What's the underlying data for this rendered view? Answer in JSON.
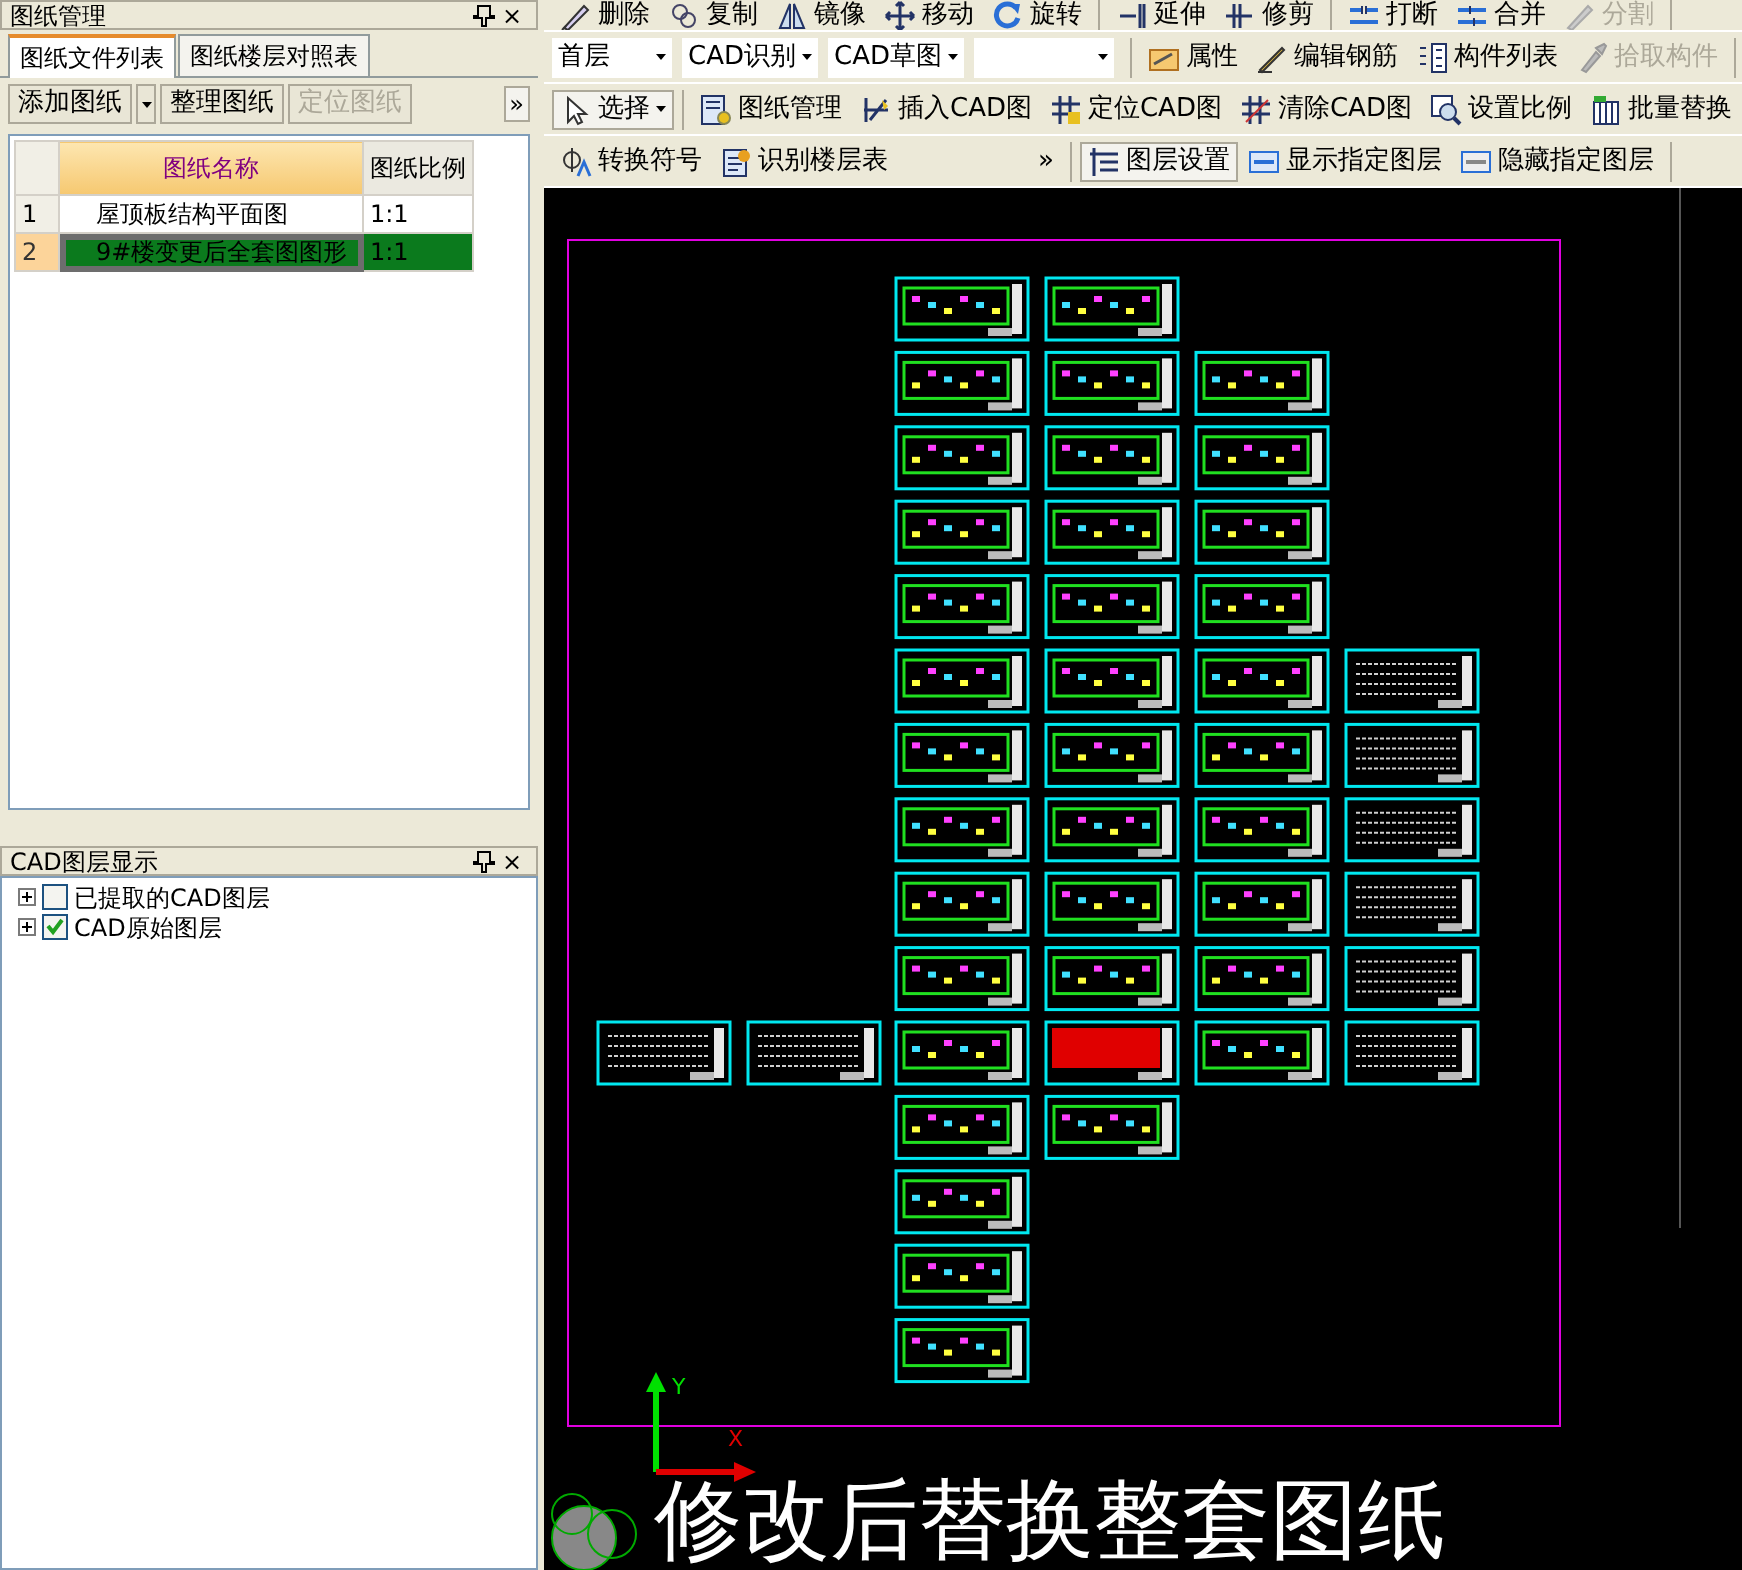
{
  "left_panel": {
    "title": "图纸管理",
    "close": "×",
    "tabs": [
      {
        "label": "图纸文件列表",
        "selected": true
      },
      {
        "label": "图纸楼层对照表",
        "selected": false
      }
    ],
    "toolbar": [
      {
        "label": "添加图纸",
        "kind": "split",
        "disabled": false
      },
      {
        "label": "整理图纸",
        "kind": "button",
        "disabled": false
      },
      {
        "label": "定位图纸",
        "kind": "button",
        "disabled": true
      }
    ],
    "overflow": "»",
    "table": {
      "columns": [
        "图纸名称",
        "图纸比例"
      ],
      "rows": [
        {
          "index": "1",
          "name": "屋顶板结构平面图",
          "scale": "1:1",
          "selected": false
        },
        {
          "index": "2",
          "name": "9#楼变更后全套图图形",
          "scale": "1:1",
          "selected": true
        }
      ]
    }
  },
  "layer_panel": {
    "title": "CAD图层显示",
    "close": "×",
    "items": [
      {
        "label": "已提取的CAD图层",
        "checked": false,
        "expanded": false
      },
      {
        "label": "CAD原始图层",
        "checked": true,
        "expanded": false
      }
    ]
  },
  "toolbars": [
    {
      "groups": [
        [
          {
            "kind": "button",
            "label": "删除",
            "disabled": false
          },
          {
            "kind": "button",
            "label": "复制",
            "disabled": false
          },
          {
            "kind": "button",
            "label": "镜像",
            "disabled": false
          },
          {
            "kind": "button",
            "label": "移动",
            "disabled": false
          },
          {
            "kind": "button",
            "label": "旋转",
            "disabled": false
          }
        ],
        [
          {
            "kind": "button",
            "label": "延伸",
            "disabled": false
          },
          {
            "kind": "button",
            "label": "修剪",
            "disabled": false
          }
        ],
        [
          {
            "kind": "button",
            "label": "打断",
            "disabled": false
          },
          {
            "kind": "button",
            "label": "合并",
            "disabled": false
          },
          {
            "kind": "button",
            "label": "分割",
            "disabled": true
          }
        ]
      ]
    },
    {
      "groups": [
        [
          {
            "kind": "dropdown",
            "value": "首层"
          },
          {
            "kind": "dropdown",
            "value": "CAD识别"
          },
          {
            "kind": "dropdown",
            "value": "CAD草图"
          },
          {
            "kind": "dropdown"
          }
        ],
        [
          {
            "kind": "button",
            "label": "属性",
            "disabled": false
          },
          {
            "kind": "button",
            "label": "编辑钢筋",
            "disabled": false
          },
          {
            "kind": "button",
            "label": "构件列表",
            "disabled": false
          },
          {
            "kind": "button",
            "label": "拾取构件",
            "disabled": true
          }
        ]
      ]
    },
    {
      "groups": [
        [
          {
            "kind": "split",
            "label": "选择",
            "selected": true
          }
        ],
        [
          {
            "kind": "button",
            "label": "图纸管理",
            "disabled": false
          },
          {
            "kind": "button",
            "label": "插入CAD图",
            "disabled": false
          },
          {
            "kind": "button",
            "label": "定位CAD图",
            "disabled": false
          },
          {
            "kind": "button",
            "label": "清除CAD图",
            "disabled": false
          },
          {
            "kind": "button",
            "label": "设置比例",
            "disabled": false
          },
          {
            "kind": "button",
            "label": "批量替换",
            "disabled": false
          }
        ]
      ]
    },
    {
      "groups": [
        [
          {
            "kind": "button",
            "label": "转换符号",
            "disabled": false
          },
          {
            "kind": "button",
            "label": "识别楼层表",
            "disabled": false
          },
          {
            "kind": "overflow",
            "label": "»"
          }
        ],
        [
          {
            "kind": "button",
            "label": "图层设置",
            "selected": true,
            "disabled": false
          },
          {
            "kind": "button",
            "label": "显示指定图层",
            "disabled": false
          },
          {
            "kind": "button",
            "label": "隐藏指定图层",
            "disabled": false
          }
        ]
      ]
    }
  ],
  "canvas": {
    "axis_y": "Y",
    "axis_x": "X",
    "caption": "修改后替换整套图纸"
  }
}
